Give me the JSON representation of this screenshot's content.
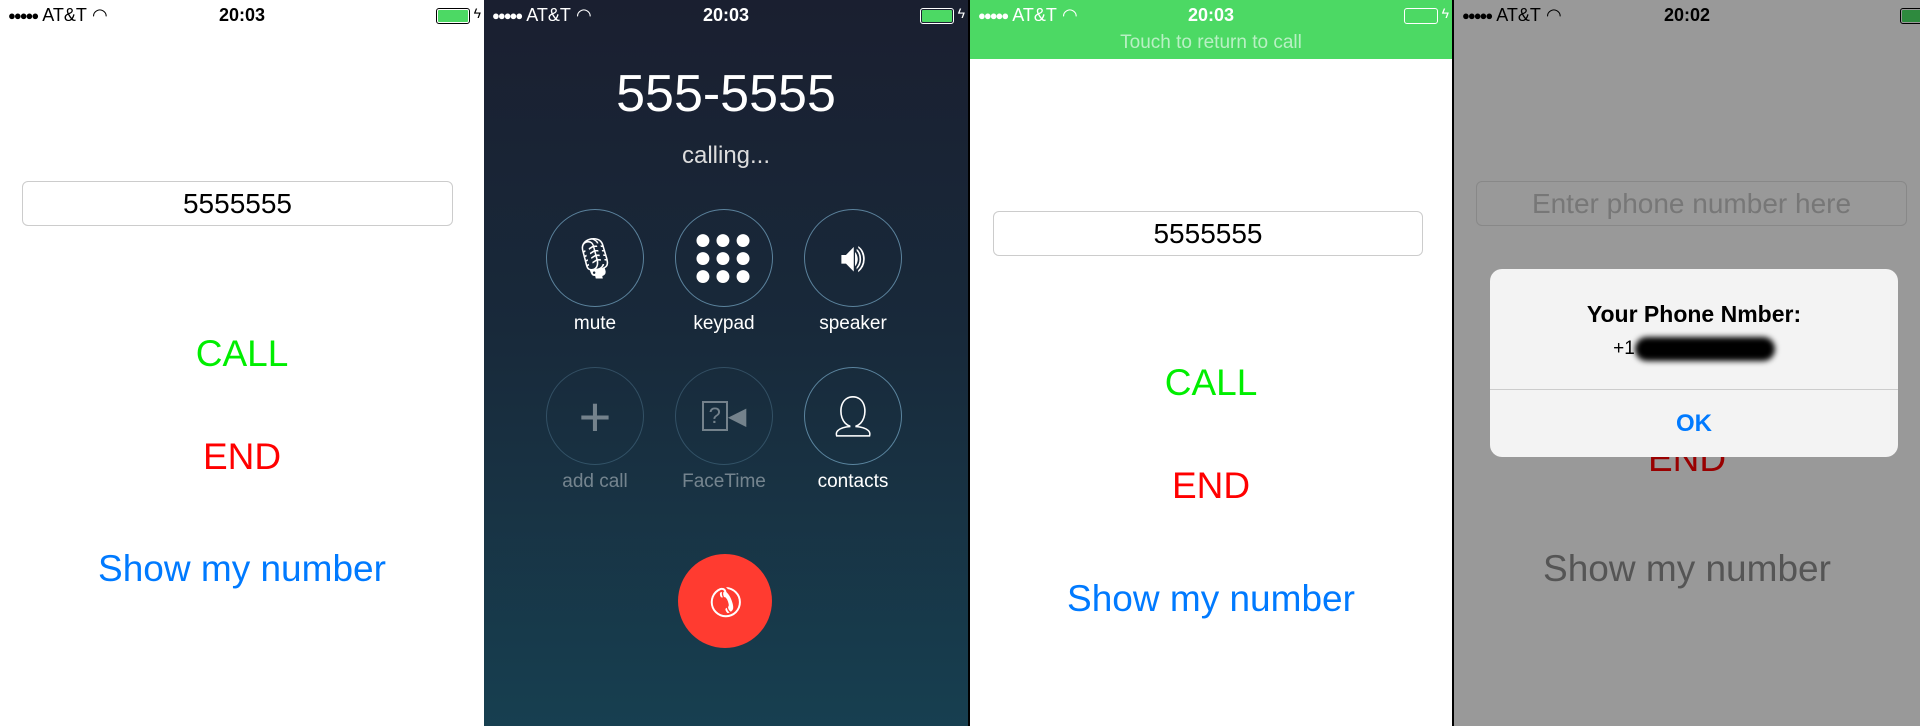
{
  "status": {
    "carrier": "AT&T",
    "time_a": "20:03",
    "time_b": "20:02"
  },
  "panel1": {
    "input_value": "5555555",
    "call": "CALL",
    "end": "END",
    "show": "Show my number"
  },
  "panel2": {
    "number": "555-5555",
    "status": "calling...",
    "buttons": [
      {
        "label": "mute",
        "icon": "mic-off-icon"
      },
      {
        "label": "keypad",
        "icon": "keypad-icon"
      },
      {
        "label": "speaker",
        "icon": "speaker-icon"
      },
      {
        "label": "add call",
        "icon": "plus-icon"
      },
      {
        "label": "FaceTime",
        "icon": "facetime-icon"
      },
      {
        "label": "contacts",
        "icon": "contact-icon"
      }
    ]
  },
  "panel3": {
    "banner": "Touch to return to call",
    "input_value": "5555555",
    "call": "CALL",
    "end": "END",
    "show": "Show my number"
  },
  "panel4": {
    "input_placeholder": "Enter phone number here",
    "end": "END",
    "show": "Show my number",
    "alert": {
      "title": "Your Phone Nmber:",
      "number_prefix": "+1",
      "ok": "OK"
    }
  },
  "colors": {
    "call": "#00ee00",
    "end": "#ff0000",
    "link": "#007aff",
    "banner": "#4cd964",
    "end_call": "#ff3b30"
  }
}
